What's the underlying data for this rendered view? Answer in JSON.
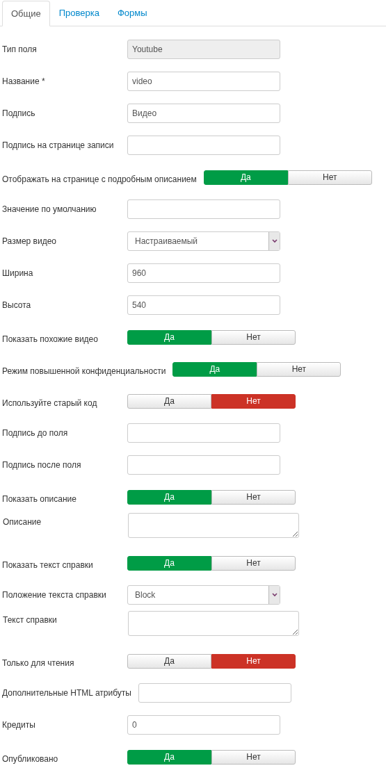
{
  "tabs": [
    {
      "label": "Общие",
      "selected": true
    },
    {
      "label": "Проверка",
      "selected": false
    },
    {
      "label": "Формы",
      "selected": false
    }
  ],
  "fields": [
    {
      "label": "Тип поля",
      "kind": "text",
      "value": "Youtube",
      "disabled": true
    },
    {
      "label": "Название *",
      "kind": "text",
      "value": "video",
      "disabled": false
    },
    {
      "label": "Подпись",
      "kind": "text",
      "value": "Видео",
      "disabled": false
    },
    {
      "label": "Подпись на странице записи",
      "kind": "text",
      "disabled": false
    },
    {
      "label": "Отображать на странице с подробным описанием",
      "kind": "toggle",
      "options": [
        {
          "label": "Да",
          "kind": "yes",
          "selected": true
        },
        {
          "label": "Нет",
          "kind": "no",
          "selected": false
        }
      ]
    },
    {
      "label": "Значение по умолчанию",
      "kind": "text",
      "disabled": false
    },
    {
      "label": "Размер видео",
      "kind": "select",
      "value": "Настраиваемый"
    },
    {
      "label": "Ширина",
      "kind": "text",
      "value": "960",
      "disabled": false
    },
    {
      "label": "Высота",
      "kind": "text",
      "value": "540",
      "disabled": false
    },
    {
      "label": "Показать похожие видео",
      "kind": "toggle",
      "options": [
        {
          "label": "Да",
          "kind": "yes",
          "selected": true
        },
        {
          "label": "Нет",
          "kind": "no",
          "selected": false
        }
      ]
    },
    {
      "label": "Режим повышенной конфиденциальности",
      "kind": "toggle",
      "options": [
        {
          "label": "Да",
          "kind": "yes",
          "selected": true
        },
        {
          "label": "Нет",
          "kind": "no",
          "selected": false
        }
      ]
    },
    {
      "label": "Используйте старый код",
      "kind": "toggle",
      "options": [
        {
          "label": "Да",
          "kind": "yes",
          "selected": false
        },
        {
          "label": "Нет",
          "kind": "no",
          "selected": true
        }
      ]
    },
    {
      "label": "Подпись до поля",
      "kind": "text",
      "disabled": false
    },
    {
      "label": "Подпись после поля",
      "kind": "text",
      "disabled": false
    },
    {
      "label": "Показать описание",
      "kind": "toggle",
      "options": [
        {
          "label": "Да",
          "kind": "yes",
          "selected": true
        },
        {
          "label": "Нет",
          "kind": "no",
          "selected": false
        }
      ]
    },
    {
      "label": "Описание",
      "kind": "textarea"
    },
    {
      "label": "Показать текст справки",
      "kind": "toggle",
      "options": [
        {
          "label": "Да",
          "kind": "yes",
          "selected": true
        },
        {
          "label": "Нет",
          "kind": "no",
          "selected": false
        }
      ]
    },
    {
      "label": "Положение текста справки",
      "kind": "select",
      "value": "Block"
    },
    {
      "label": "Текст справки",
      "kind": "textarea"
    },
    {
      "label": "Только для чтения",
      "kind": "toggle",
      "options": [
        {
          "label": "Да",
          "kind": "yes",
          "selected": false
        },
        {
          "label": "Нет",
          "kind": "no",
          "selected": true
        }
      ]
    },
    {
      "label": "Дополнительные HTML атрибуты",
      "kind": "text",
      "disabled": false
    },
    {
      "label": "Кредиты",
      "kind": "text",
      "value": "0",
      "disabled": false
    },
    {
      "label": "Опубликовано",
      "kind": "toggle",
      "options": [
        {
          "label": "Да",
          "kind": "yes",
          "selected": true
        },
        {
          "label": "Нет",
          "kind": "no",
          "selected": false
        }
      ]
    }
  ]
}
